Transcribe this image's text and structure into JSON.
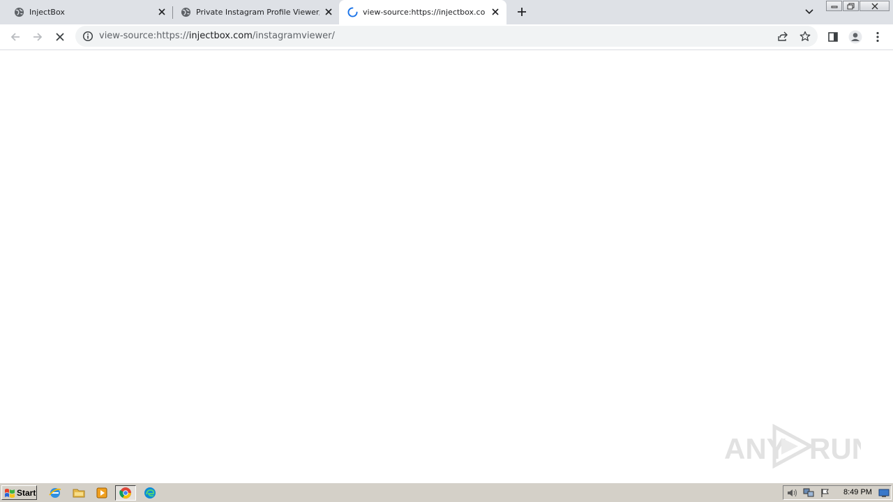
{
  "browser": {
    "tabs": [
      {
        "title": "InjectBox",
        "favicon": "globe-icon",
        "active": false
      },
      {
        "title": "Private Instagram Profile Viewer/Unlo",
        "favicon": "globe-icon",
        "active": false
      },
      {
        "title": "view-source:https://injectbox.com/ins",
        "favicon": "loading-spinner-icon",
        "active": true
      }
    ],
    "address_bar": {
      "prefix": "view-source:https://",
      "host": "injectbox.com",
      "path": "/instagramviewer/"
    }
  },
  "watermark": {
    "text_left": "ANY",
    "text_right": "RUN"
  },
  "taskbar": {
    "start_label": "Start",
    "quick_launch": [
      "internet-explorer-icon",
      "folder-icon",
      "media-player-icon",
      "chrome-icon",
      "edge-icon"
    ],
    "clock": "8:49 PM"
  },
  "colors": {
    "tabstrip": "#dee1e6",
    "omnibox": "#f1f3f4",
    "taskbar": "#d4d0c8",
    "spinner": "#1a73e8"
  }
}
